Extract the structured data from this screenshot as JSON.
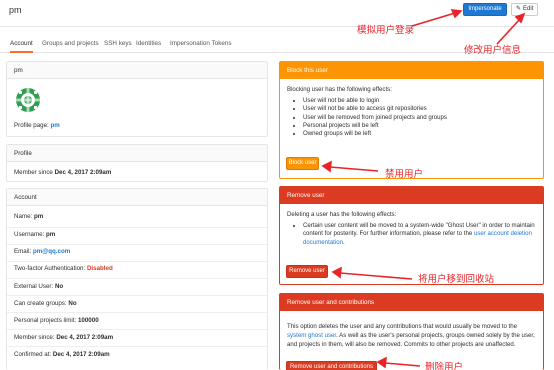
{
  "header": {
    "username": "pm",
    "impersonate_label": "Impersonate",
    "edit_label": "Edit"
  },
  "tabs": [
    {
      "label": "Account",
      "active": true
    },
    {
      "label": "Groups and projects",
      "active": false
    },
    {
      "label": "SSH keys",
      "active": false
    },
    {
      "label": "Identities",
      "active": false
    },
    {
      "label": "Impersonation Tokens",
      "active": false
    }
  ],
  "user_card": {
    "title": "pm",
    "profile_label": "Profile page:",
    "profile_value": "pm"
  },
  "profile_card": {
    "title": "Profile",
    "member_label": "Member since",
    "member_value": "Dec 4, 2017 2:09am"
  },
  "account_card": {
    "title": "Account",
    "name_label": "Name:",
    "name_value": "pm",
    "username_label": "Username:",
    "username_value": "pm",
    "email_label": "Email:",
    "email_value": "pm@qq.com",
    "twofa_label": "Two-factor Authentication:",
    "twofa_value": "Disabled",
    "external_label": "External User:",
    "external_value": "No",
    "groups_label": "Can create groups:",
    "groups_value": "No",
    "limit_label": "Personal projects limit:",
    "limit_value": "100000",
    "member_label": "Member since:",
    "member_value": "Dec 4, 2017 2:09am",
    "confirmed_label": "Confirmed at:",
    "confirmed_value": "Dec 4, 2017 2:09am"
  },
  "block_box": {
    "title": "Block this user",
    "intro": "Blocking user has the following effects:",
    "effects": [
      "User will not be able to login",
      "User will not be able to access git repositories",
      "User will be removed from joined projects and groups",
      "Personal projects will be left",
      "Owned groups will be left"
    ],
    "button": "Block user"
  },
  "remove_box": {
    "title": "Remove user",
    "intro": "Deleting a user has the following effects:",
    "text_1": "Certain user content will be moved to a system-wide \"Ghost User\" in order to maintain content for posterity. For further information, please refer to the",
    "link": "user account deletion documentation",
    "text_2": ".",
    "button": "Remove user"
  },
  "remove_contrib_box": {
    "title": "Remove user and contributions",
    "text_1": "This option deletes the user and any contributions that would usually be moved to the",
    "link": "system ghost user",
    "text_2": ". As well as the user's personal projects, groups owned solely by the user, and projects in them, will also be removed. Commits to other projects are unaffected.",
    "button": "Remove user and contributions"
  },
  "annotations": {
    "impersonate": "模拟用户登录",
    "edit": "修改用户信息",
    "block": "禁用用户",
    "remove": "将用户移到回收站",
    "remove_contrib": "删除用户"
  },
  "colors": {
    "primary": "#1f78d1",
    "warning": "#fc9403",
    "danger": "#db3b21",
    "annotation": "#e8242a",
    "tab_active": "#fc6d26"
  }
}
